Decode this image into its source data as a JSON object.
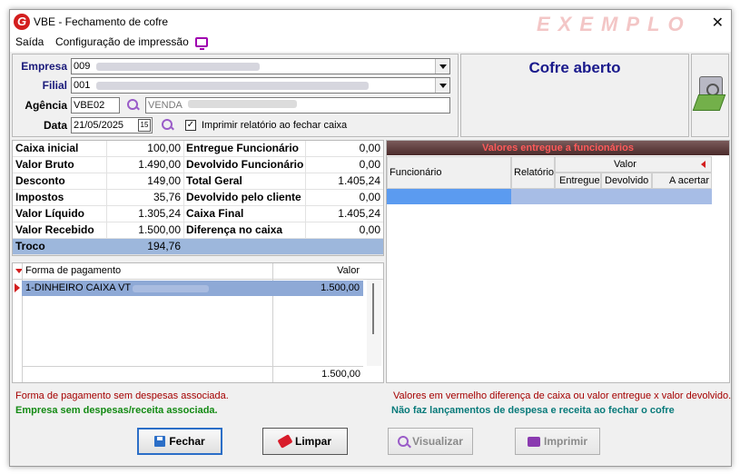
{
  "window": {
    "title": "VBE - Fechamento de cofre",
    "watermark": "EXEMPLO",
    "close_glyph": "✕"
  },
  "menu": {
    "items": [
      "Saída",
      "Configuração de impressão"
    ]
  },
  "form": {
    "empresa_label": "Empresa",
    "empresa_value": "009",
    "filial_label": "Filial",
    "filial_value": "001",
    "agencia_label": "Agência",
    "agencia_code": "VBE02",
    "agencia_name": "VENDA",
    "data_label": "Data",
    "data_value": "21/05/2025",
    "cal_glyph": "15",
    "print_checkbox_label": "Imprimir relatório ao fechar caixa",
    "print_checkbox_checked": true
  },
  "status": {
    "text": "Cofre aberto"
  },
  "summary": {
    "left": [
      {
        "label": "Caixa inicial",
        "value": "100,00"
      },
      {
        "label": "Valor Bruto",
        "value": "1.490,00"
      },
      {
        "label": "Desconto",
        "value": "149,00"
      },
      {
        "label": "Impostos",
        "value": "35,76"
      },
      {
        "label": "Valor Líquido",
        "value": "1.305,24"
      },
      {
        "label": "Valor Recebido",
        "value": "1.500,00"
      },
      {
        "label": "Troco",
        "value": "194,76"
      }
    ],
    "right": [
      {
        "label": "Entregue Funcionário",
        "value": "0,00"
      },
      {
        "label": "Devolvido Funcionário",
        "value": "0,00"
      },
      {
        "label": "Total Geral",
        "value": "1.405,24"
      },
      {
        "label": "Devolvido pelo cliente",
        "value": "0,00"
      },
      {
        "label": "Caixa Final",
        "value": "1.405,24"
      },
      {
        "label": "Diferença no caixa",
        "value": "0,00"
      }
    ]
  },
  "payments": {
    "columns": [
      "Forma de pagamento",
      "Valor"
    ],
    "rows": [
      {
        "forma": "1-DINHEIRO CAIXA  VT",
        "valor": "1.500,00"
      }
    ],
    "total": "1.500,00"
  },
  "funcionarios": {
    "title": "Valores entregue a funcionários",
    "col_funcionario": "Funcionário",
    "col_relatorio": "Relatório",
    "col_valor": "Valor",
    "col_entregue": "Entregue",
    "col_devolvido": "Devolvido",
    "col_acertar": "A acertar"
  },
  "messages": {
    "left_top": "Forma de pagamento sem despesas associada.",
    "left_bottom": "Empresa sem despesas/receita associada.",
    "right_top": "Valores em vermelho diferença de caixa ou valor entregue x valor devolvido.",
    "right_bottom": "Não faz lançamentos de despesa e receita ao fechar o cofre"
  },
  "buttons": {
    "fechar": "Fechar",
    "limpar": "Limpar",
    "visualizar": "Visualizar",
    "imprimir": "Imprimir"
  },
  "colors": {
    "accent": "#1a1a8c",
    "selection": "#9db7dc",
    "error": "#a50000",
    "ok": "#138a13"
  }
}
